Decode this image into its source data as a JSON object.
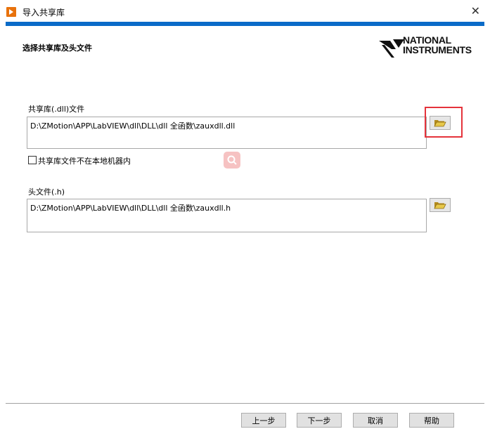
{
  "window": {
    "title": "导入共享库",
    "close_symbol": "✕"
  },
  "header": {
    "title": "选择共享库及头文件"
  },
  "logo": {
    "line1": "NATIONAL",
    "line2": "INSTRUMENTS"
  },
  "dll_section": {
    "label": "共享库(.dll)文件",
    "path": "D:\\ZMotion\\APP\\LabVIEW\\dll\\DLL\\dll 全函数\\zauxdll.dll"
  },
  "not_local_checkbox": {
    "label": "共享库文件不在本地机器内",
    "checked": false
  },
  "header_section": {
    "label": "头文件(.h)",
    "path": "D:\\ZMotion\\APP\\LabVIEW\\dll\\DLL\\dll 全函数\\zauxdll.h"
  },
  "footer": {
    "back_label": "上一步",
    "next_label": "下一步",
    "cancel_label": "取消",
    "help_label": "帮助"
  },
  "colors": {
    "accent_band": "#0a6bc8",
    "highlight": "#e5333b",
    "folder": "#e7c84a"
  }
}
